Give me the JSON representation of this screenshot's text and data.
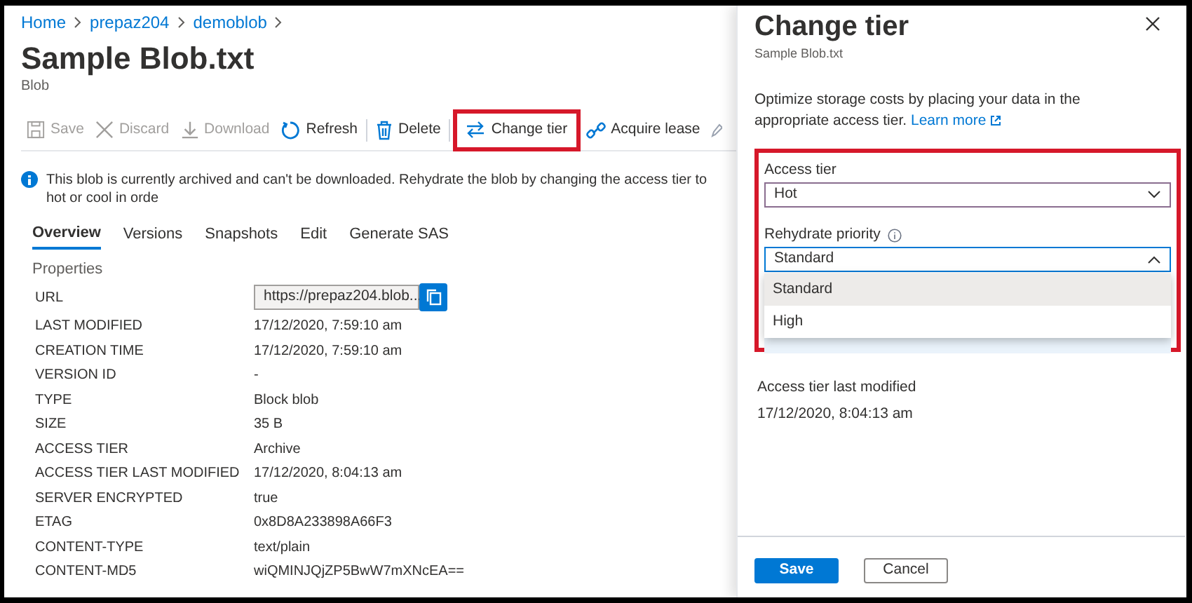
{
  "breadcrumb": [
    {
      "label": "Home"
    },
    {
      "label": "prepaz204"
    },
    {
      "label": "demoblob"
    }
  ],
  "title": "Sample Blob.txt",
  "subtitle": "Blob",
  "toolbar": [
    {
      "label": "Save",
      "disabled": true,
      "highlighted": false
    },
    {
      "label": "Discard",
      "disabled": true,
      "highlighted": false
    },
    {
      "label": "Download",
      "disabled": true,
      "highlighted": false
    },
    {
      "label": "Refresh",
      "disabled": false,
      "highlighted": false
    },
    {
      "label": "Delete",
      "disabled": false,
      "highlighted": false
    },
    {
      "label": "Change tier",
      "disabled": false,
      "highlighted": true
    },
    {
      "label": "Acquire lease",
      "disabled": false,
      "highlighted": false
    }
  ],
  "info_banner": "This blob is currently archived and can't be downloaded. Rehydrate the blob by changing the access tier to hot or cool in orde",
  "tabs": [
    {
      "label": "Overview",
      "selected": true
    },
    {
      "label": "Versions",
      "selected": false
    },
    {
      "label": "Snapshots",
      "selected": false
    },
    {
      "label": "Edit",
      "selected": false
    },
    {
      "label": "Generate SAS",
      "selected": false
    }
  ],
  "properties": {
    "heading": "Properties",
    "rows": [
      {
        "kind": "copy-field",
        "label": "URL",
        "value": "https://prepaz204.blob..."
      },
      {
        "kind": "text",
        "label": "LAST MODIFIED",
        "value": "17/12/2020, 7:59:10 am"
      },
      {
        "kind": "text",
        "label": "CREATION TIME",
        "value": "17/12/2020, 7:59:10 am"
      },
      {
        "kind": "text",
        "label": "VERSION ID",
        "value": "-"
      },
      {
        "kind": "text",
        "label": "TYPE",
        "value": "Block blob"
      },
      {
        "kind": "text",
        "label": "SIZE",
        "value": "35 B"
      },
      {
        "kind": "text",
        "label": "ACCESS TIER",
        "value": "Archive"
      },
      {
        "kind": "text",
        "label": "ACCESS TIER LAST MODIFIED",
        "value": "17/12/2020, 8:04:13 am"
      },
      {
        "kind": "text",
        "label": "SERVER ENCRYPTED",
        "value": "true"
      },
      {
        "kind": "text",
        "label": "ETAG",
        "value": "0x8D8A233898A66F3"
      },
      {
        "kind": "text",
        "label": "CONTENT-TYPE",
        "value": "text/plain"
      },
      {
        "kind": "text",
        "label": "CONTENT-MD5",
        "value": "wiQMINJQjZP5BwW7mXNcEA=="
      }
    ]
  },
  "panel": {
    "title": "Change tier",
    "subtitle": "Sample Blob.txt",
    "description": "Optimize storage costs by placing your data in the appropriate access tier.",
    "link": "Learn more",
    "highlighted": true,
    "access_tier": {
      "label": "Access tier",
      "value": "Hot",
      "expanded": false
    },
    "rehydrate_priority": {
      "label": "Rehydrate priority",
      "value": "Standard",
      "expanded": true,
      "options": [
        {
          "label": "Standard",
          "selected": true
        },
        {
          "label": "High",
          "selected": false
        }
      ]
    },
    "last_modified": {
      "label": "Access tier last modified",
      "value": "17/12/2020, 8:04:13 am"
    },
    "buttons": [
      {
        "label": "Save",
        "kind": "primary"
      },
      {
        "label": "Cancel",
        "kind": "secondary"
      }
    ]
  }
}
